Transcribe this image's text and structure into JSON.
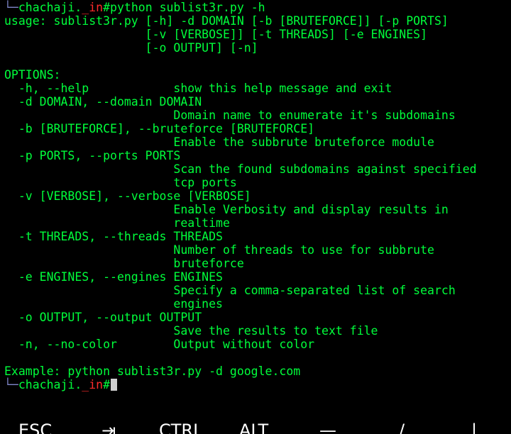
{
  "prompt": {
    "corner": "└─",
    "user": "chachaji.",
    "sep": "_in",
    "symbol": "#"
  },
  "command": "python sublist3r.py -h",
  "usage": [
    "usage: sublist3r.py [-h] -d DOMAIN [-b [BRUTEFORCE]] [-p PORTS]",
    "                    [-v [VERBOSE]] [-t THREADS] [-e ENGINES]",
    "                    [-o OUTPUT] [-n]"
  ],
  "options_header": "OPTIONS:",
  "options": [
    "  -h, --help            show this help message and exit",
    "  -d DOMAIN, --domain DOMAIN",
    "                        Domain name to enumerate it's subdomains",
    "  -b [BRUTEFORCE], --bruteforce [BRUTEFORCE]",
    "                        Enable the subbrute bruteforce module",
    "  -p PORTS, --ports PORTS",
    "                        Scan the found subdomains against specified",
    "                        tcp ports",
    "  -v [VERBOSE], --verbose [VERBOSE]",
    "                        Enable Verbosity and display results in",
    "                        realtime",
    "  -t THREADS, --threads THREADS",
    "                        Number of threads to use for subbrute",
    "                        bruteforce",
    "  -e ENGINES, --engines ENGINES",
    "                        Specify a comma-separated list of search",
    "                        engines",
    "  -o OUTPUT, --output OUTPUT",
    "                        Save the results to text file",
    "  -n, --no-color        Output without color"
  ],
  "example": "Example: python sublist3r.py -d google.com",
  "extra_keys": [
    {
      "name": "esc",
      "label": "ESC"
    },
    {
      "name": "tab",
      "label": "⇥"
    },
    {
      "name": "ctrl",
      "label": "CTRL"
    },
    {
      "name": "alt",
      "label": "ALT"
    },
    {
      "name": "dash",
      "label": "—"
    },
    {
      "name": "slash",
      "label": "/"
    },
    {
      "name": "pipe",
      "label": "|"
    }
  ]
}
